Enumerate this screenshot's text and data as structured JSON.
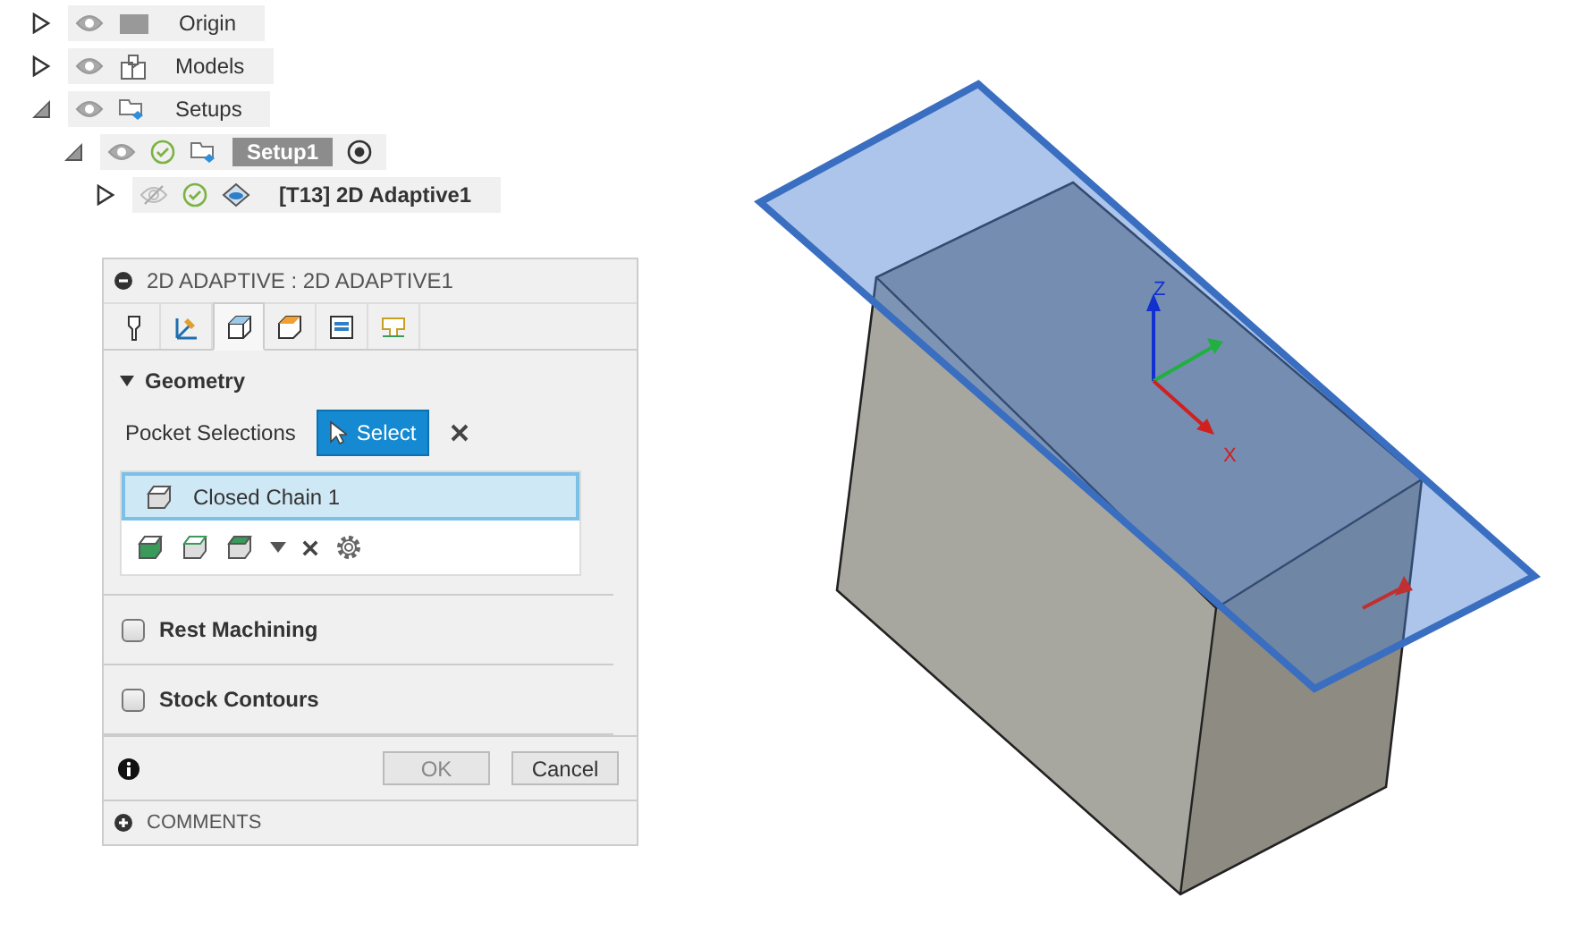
{
  "browser": {
    "items": [
      {
        "label": "Origin",
        "kind": "origin",
        "expanded": false,
        "visible": true,
        "ok": false,
        "selected": false,
        "active": false
      },
      {
        "label": "Models",
        "kind": "models",
        "expanded": false,
        "visible": true,
        "ok": false,
        "selected": false,
        "active": false
      },
      {
        "label": "Setups",
        "kind": "setups",
        "expanded": true,
        "visible": true,
        "ok": false,
        "selected": false,
        "active": false,
        "children": [
          {
            "label": "Setup1",
            "kind": "setup",
            "expanded": true,
            "visible": true,
            "ok": true,
            "selected": true,
            "active": true,
            "children": [
              {
                "label": "[T13] 2D Adaptive1",
                "kind": "operation",
                "expanded": false,
                "visible": false,
                "ok": true,
                "selected": false,
                "active": false
              }
            ]
          }
        ]
      }
    ]
  },
  "dialog": {
    "title": "2D ADAPTIVE : 2D ADAPTIVE1",
    "expanded": true,
    "tabs": [
      {
        "kind": "tool",
        "selected": false
      },
      {
        "kind": "axes",
        "selected": false
      },
      {
        "kind": "geometry",
        "selected": true
      },
      {
        "kind": "heights",
        "selected": false
      },
      {
        "kind": "passes",
        "selected": false
      },
      {
        "kind": "linking",
        "selected": false
      }
    ],
    "sections": [
      {
        "kind": "group",
        "title": "Geometry",
        "expanded": true,
        "field_label": "Pocket Selections",
        "select_button": "Select",
        "select_active": true,
        "selections": [
          {
            "label": "Closed Chain 1",
            "selected": true
          }
        ]
      },
      {
        "kind": "checkbox",
        "title": "Rest Machining",
        "checked": false
      },
      {
        "kind": "checkbox",
        "title": "Stock Contours",
        "checked": false
      }
    ],
    "buttons": [
      {
        "label": "OK",
        "disabled": true
      },
      {
        "label": "Cancel",
        "disabled": false
      }
    ],
    "comments": {
      "label": "COMMENTS",
      "expanded": false
    }
  },
  "viewport": {
    "axis_labels": [
      "Z",
      "X"
    ]
  }
}
